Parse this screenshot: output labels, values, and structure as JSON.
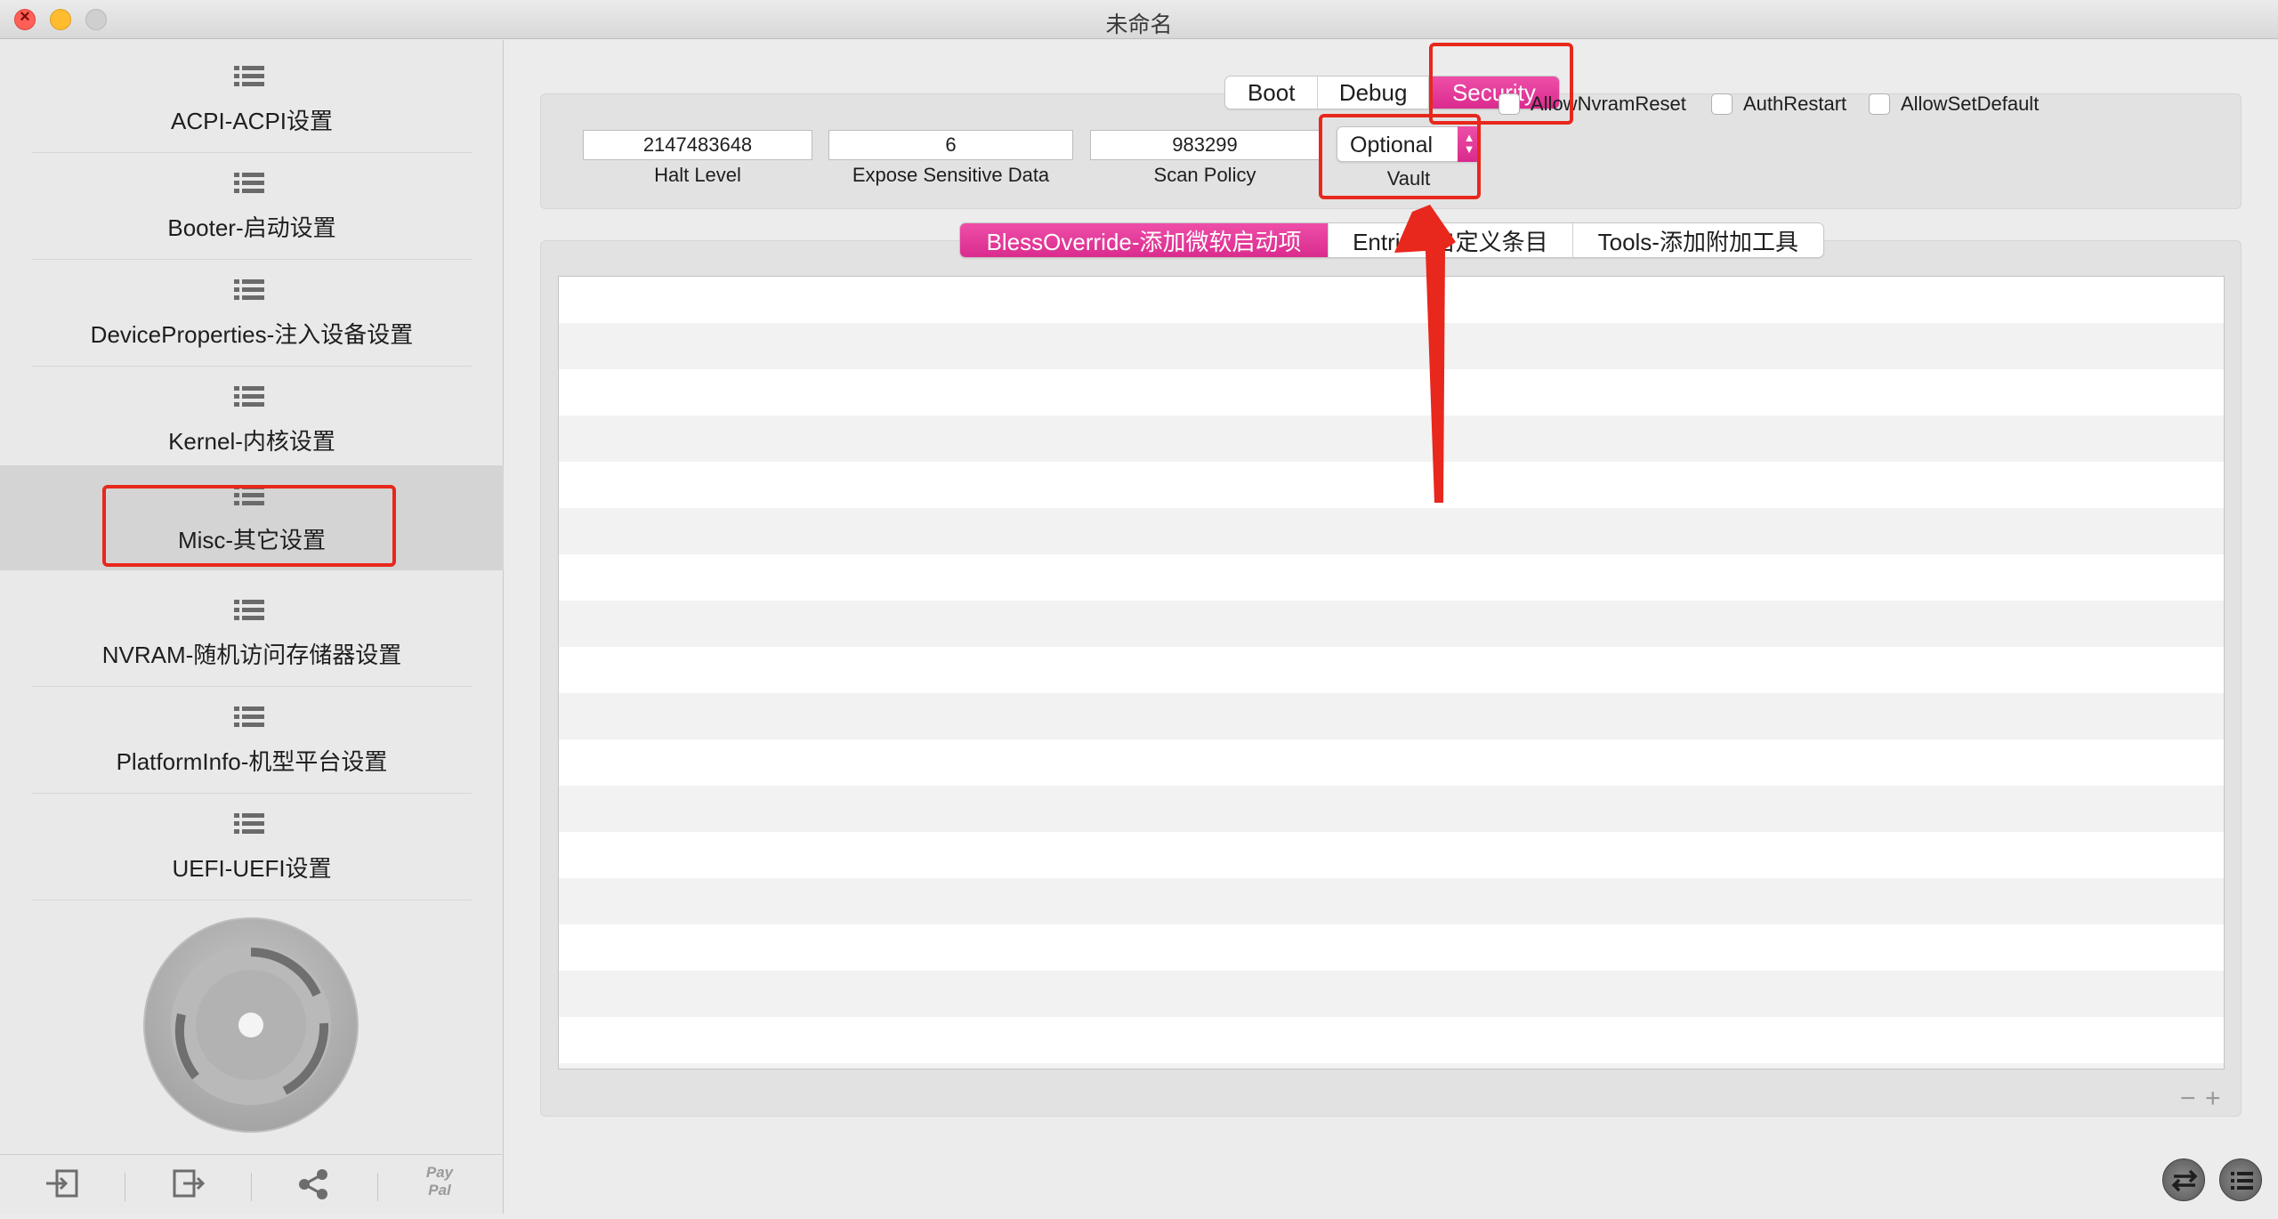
{
  "window": {
    "title": "未命名"
  },
  "sidebar": {
    "items": [
      {
        "label": "ACPI-ACPI设置",
        "icon": "list-icon"
      },
      {
        "label": "Booter-启动设置",
        "icon": "list-icon"
      },
      {
        "label": "DeviceProperties-注入设备设置",
        "icon": "list-icon"
      },
      {
        "label": "Kernel-内核设置",
        "icon": "list-icon"
      },
      {
        "label": "Misc-其它设置",
        "icon": "list-icon"
      },
      {
        "label": "NVRAM-随机访问存储器设置",
        "icon": "list-icon"
      },
      {
        "label": "PlatformInfo-机型平台设置",
        "icon": "list-icon"
      },
      {
        "label": "UEFI-UEFI设置",
        "icon": "list-icon"
      }
    ],
    "selected_item": "Misc-其它设置",
    "toolbar": {
      "buttons": [
        "import-icon",
        "export-icon",
        "share-icon",
        "paypal-icon"
      ],
      "paypal_line1": "Pay",
      "paypal_line2": "Pal"
    }
  },
  "misc": {
    "top_tabs": [
      "Boot",
      "Debug",
      "Security"
    ],
    "active_top_tab": "Security",
    "security": {
      "halt_level": {
        "value": "2147483648",
        "label": "Halt Level"
      },
      "expose_sensitive_data": {
        "value": "6",
        "label": "Expose Sensitive Data"
      },
      "scan_policy": {
        "value": "983299",
        "label": "Scan Policy"
      },
      "vault": {
        "value": "Optional",
        "label": "Vault"
      },
      "checkboxes": [
        {
          "label": "AllowNvramReset",
          "checked": false
        },
        {
          "label": "AuthRestart",
          "checked": false
        },
        {
          "label": "AllowSetDefault",
          "checked": false
        }
      ]
    },
    "lower_tabs": [
      "BlessOverride-添加微软启动项",
      "Entries-自定义条目",
      "Tools-添加附加工具"
    ],
    "active_lower_tab": "BlessOverride-添加微软启动项",
    "table_rows": []
  },
  "bottom_right": {
    "buttons": [
      "swap-icon",
      "list-view-icon"
    ]
  },
  "colors": {
    "accent": "#e0359a",
    "annotation": "#e8271d"
  }
}
